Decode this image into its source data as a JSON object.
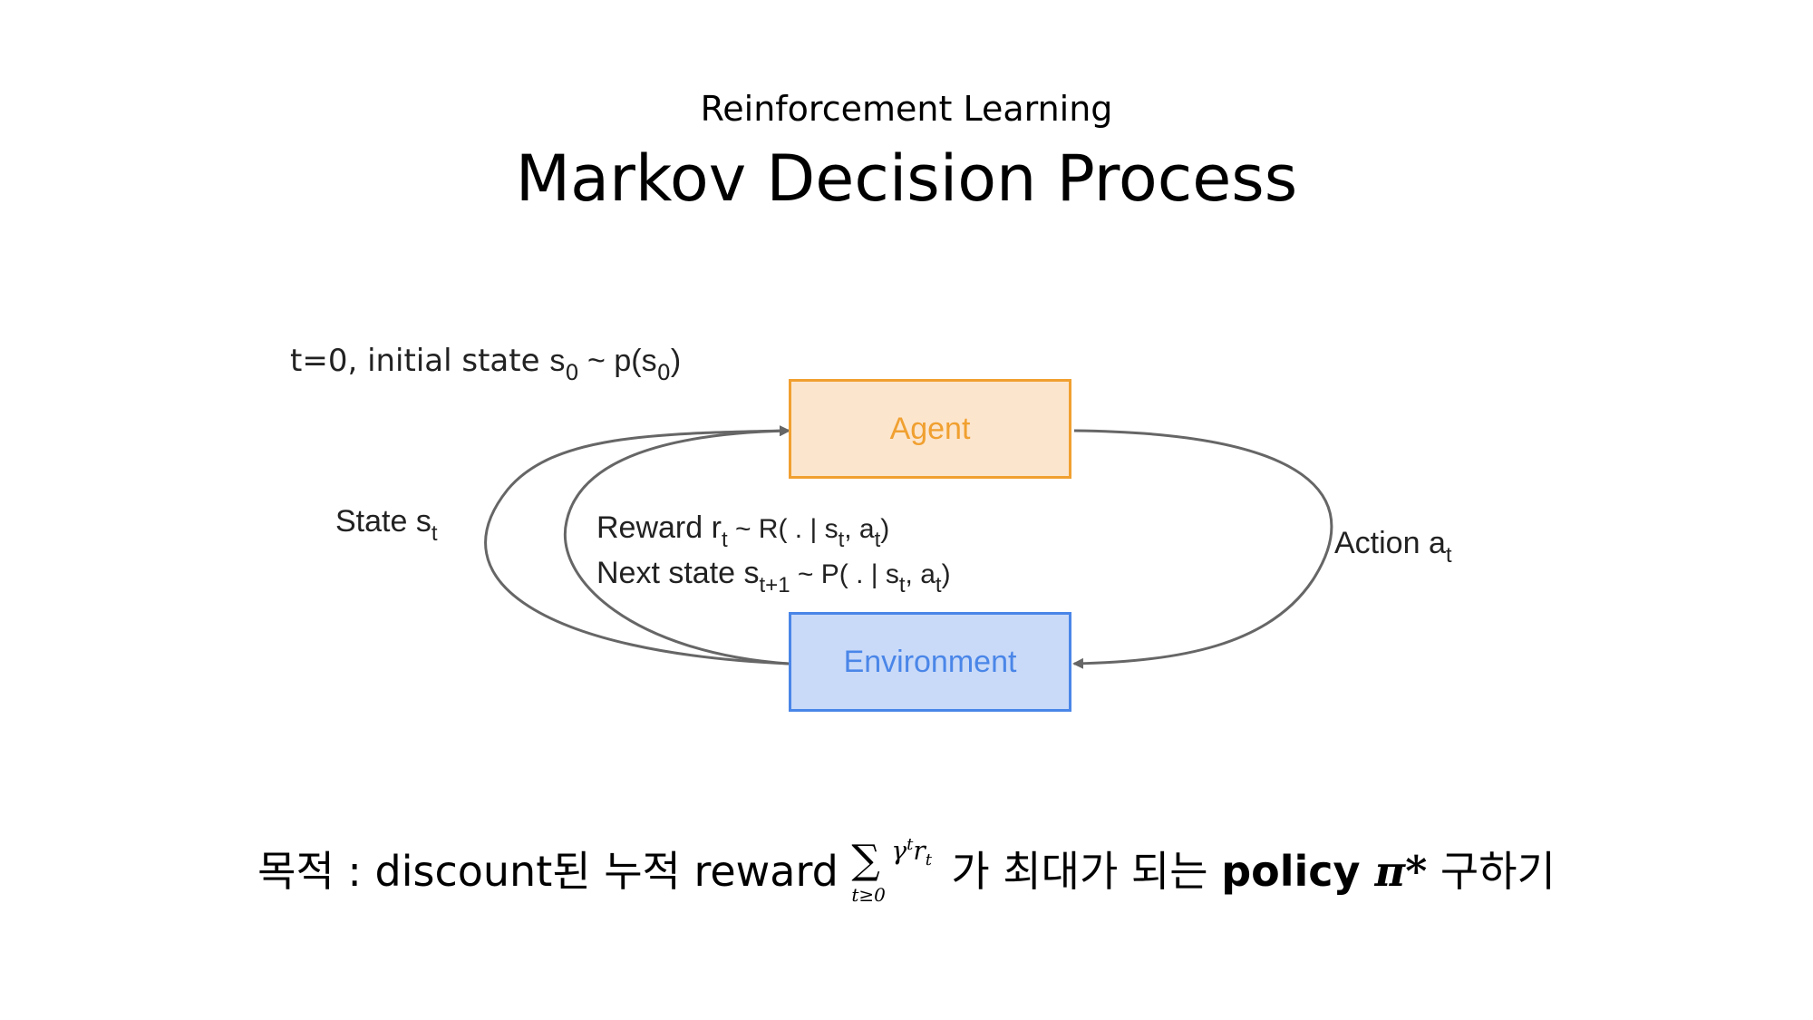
{
  "header": {
    "subtitle": "Reinforcement Learning",
    "title": "Markov Decision Process"
  },
  "diagram": {
    "agent": "Agent",
    "environment": "Environment",
    "initial": {
      "prefix": "t=0, initial state ",
      "s": "s",
      "sub1": "0",
      "mid": " ~ p(s",
      "sub2": "0",
      "end": ")"
    },
    "state": {
      "text": "State s",
      "sub": "t"
    },
    "reward": {
      "text": "Reward r",
      "sub": "t",
      "rest1": "  ~ R( . | s",
      "sub2": "t",
      "rest2": ", a",
      "sub3": "t",
      "end": ")"
    },
    "next_state": {
      "text": "Next state s",
      "sub": "t+1",
      "rest1": " ~ P( . | s",
      "sub2": "t",
      "rest2": ", a",
      "sub3": "t",
      "end": ")"
    },
    "action": {
      "text": "Action a",
      "sub": "t"
    }
  },
  "goal": {
    "prefix": "목적 : discount된 누적 reward ",
    "sigma": "∑",
    "sum_sub": "t≥0",
    "gamma": "γ",
    "gamma_sup": "t",
    "r": "r",
    "r_sub": "t",
    "middle": "가 최대가 되는 ",
    "policy": "policy ",
    "pi": "π*",
    "suffix": " 구하기"
  },
  "colors": {
    "agent_fill": "#fce5cd",
    "agent_border": "#f0a030",
    "env_fill": "#c9daf8",
    "env_border": "#4a86e8",
    "arrow": "#666666"
  }
}
